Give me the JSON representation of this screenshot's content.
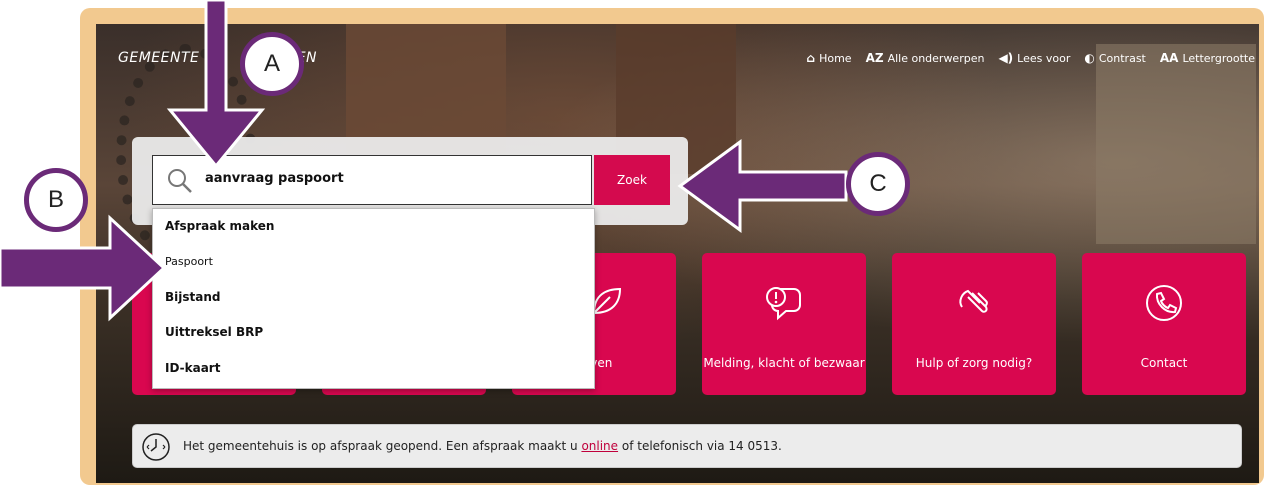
{
  "header": {
    "logo_left": "GEMEENTE",
    "logo_right": "EEN",
    "nav": [
      {
        "icon": "home-icon",
        "glyph": "⌂",
        "label": "Home"
      },
      {
        "icon": "az-icon",
        "glyph": "AZ",
        "label": "Alle onderwerpen"
      },
      {
        "icon": "speaker-icon",
        "glyph": "◀)",
        "label": "Lees voor"
      },
      {
        "icon": "contrast-icon",
        "glyph": "◐",
        "label": "Contrast"
      },
      {
        "icon": "font-size-icon",
        "glyph": "AA",
        "label": "Lettergrootte"
      }
    ]
  },
  "search": {
    "value": "aanvraag paspoort",
    "button_label": "Zoek",
    "suggestions": [
      "Afspraak maken",
      "Paspoort",
      "Bijstand",
      "Uittreksel BRP",
      "ID-kaart"
    ]
  },
  "tiles": [
    {
      "label": "",
      "icon": "hidden-icon"
    },
    {
      "label": "",
      "icon": "hidden-icon"
    },
    {
      "label": "orven",
      "icon": "leaf-icon"
    },
    {
      "label": "Melding, klacht of bezwaar",
      "icon": "speech-exclamation-icon"
    },
    {
      "label": "Hulp of zorg nodig?",
      "icon": "helping-hands-icon"
    },
    {
      "label": "Contact",
      "icon": "phone-icon"
    }
  ],
  "notice": {
    "text_before": "Het gemeentehuis is op afspraak geopend. Een afspraak maakt u ",
    "link": "online",
    "text_after": " of telefonisch via 14 0513."
  },
  "markers": {
    "a": "A",
    "b": "B",
    "c": "C"
  },
  "colors": {
    "accent": "#d9074f",
    "frame": "#f2c98f",
    "arrow": "#6b2a78"
  }
}
